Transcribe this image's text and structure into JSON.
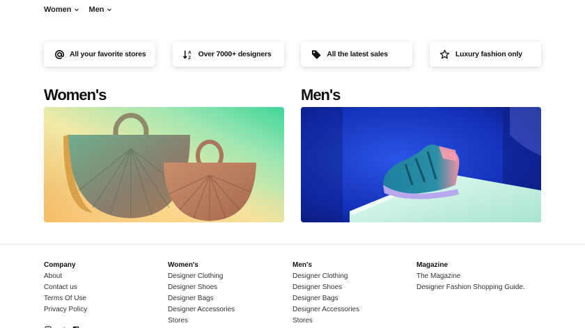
{
  "nav": {
    "items": [
      {
        "label": "Women"
      },
      {
        "label": "Men"
      }
    ]
  },
  "features": [
    {
      "icon": "at-sign-icon",
      "label": "All your favorite stores"
    },
    {
      "icon": "sort-az-icon",
      "label": "Over 7000+ designers"
    },
    {
      "icon": "price-tag-icon",
      "label": "All the latest sales"
    },
    {
      "icon": "star-outline-icon",
      "label": "Luxury fashion only"
    }
  ],
  "categories": {
    "women": {
      "title": "Women's",
      "image": "two-woven-handbags-photo"
    },
    "men": {
      "title": "Men's",
      "image": "sneaker-on-pedestal-photo"
    }
  },
  "footer": {
    "company": {
      "heading": "Company",
      "links": [
        "About",
        "Contact us",
        "Terms Of Use",
        "Privacy Policy"
      ]
    },
    "womens": {
      "heading": "Women's",
      "links": [
        "Designer Clothing",
        "Designer Shoes",
        "Designer Bags",
        "Designer Accessories",
        "Stores"
      ]
    },
    "mens": {
      "heading": "Men's",
      "links": [
        "Designer Clothing",
        "Designer Shoes",
        "Designer Bags",
        "Designer Accessories",
        "Stores"
      ]
    },
    "magazine": {
      "heading": "Magazine",
      "links": [
        "The Magazine",
        "Designer Fashion Shopping Guide."
      ]
    }
  },
  "social": [
    "instagram-icon",
    "twitter-icon",
    "facebook-icon"
  ]
}
